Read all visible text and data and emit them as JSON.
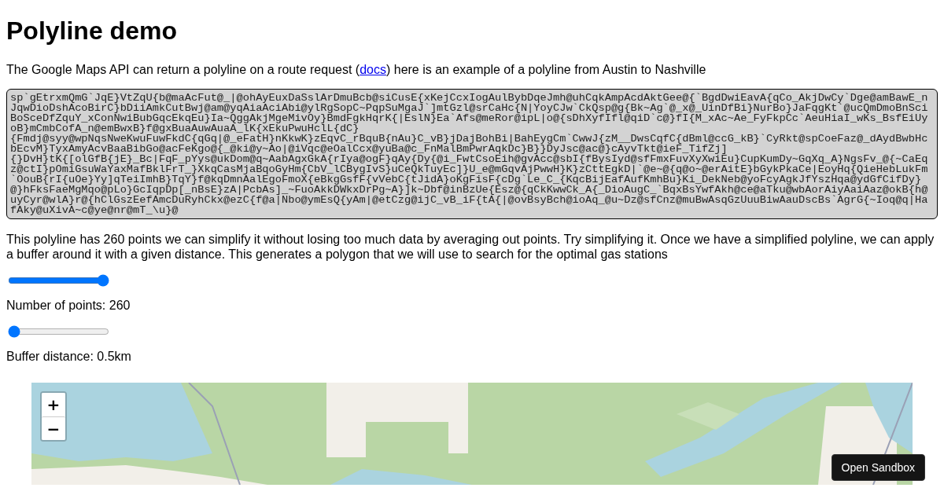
{
  "heading": "Polyline demo",
  "intro": {
    "before": "The Google Maps API can return a polyline on a route request (",
    "link": "docs",
    "after": ") here is an example of a polyline from Austin to Nashville"
  },
  "polyline": [
    "sp`gEtrxmQmG`JqE}VtZqU{b@maAcFut@_|@ohAyEuxDaSslArDmuBcb@siCusE{xKejCcxIogAulBybDqeJmh@uhCqkAmpAcdAktGee@{`BgdDwiEavA{qCo_AkjDwCy`Dge@amBawE_nJqwDioDshAcoBirC}bDiiAmkCutBwj@am@yqAiaAciAbi@ylRgSopC~PqpSuMgaJ`]mtGzl@srCaHc{N|YoyCJw`CkQsp@g{Bk~Ag`@_x@_UinDfBi}NurBo}JaFqgKt`@ucQmDmoBnSciBoSceDfZquY_xConNwiBubGqcEkqEu}Ia~QggAkjMgeMivOy}BmdFgkHqrK{|EslN}Ea`Afs@meRor@ipL|o@{sDhXyfIfl@qiD`c@}fI{M_xAc~Ae_FyFkpCc`AeuHiaI_wKs_BsfEiUyoB}mCmbCofA_n@emBwxB}f@gxBuaAuwAuaA_lK{xEkuPwuHclL{dC}",
    "{Fmdj@syy@wpNqsNweKwuFuwFkdC{qGq|@_eFatH}nKkwK}zEqvC_rBquB{nAu}C_vB}jDajBohBi|BahEygCm`CwwJ{zM__DwsCqfC{dBml@ccG_kB}`CyRkt@spCoeFaz@_dAydBwbHcbEcvM}TyxAmyAcvBaaBibGo@acFeKgo@{_@ki@y~Ao|@iVqc@eOalCcx@yuBa@c_FnMalBmPwrAqkDc}B}}DyJsc@ac@}cAyvTkt@ieF_TifZj]",
    "{}DvH}tK{[olGfB{jE}_Bc|FqF_pYys@ukDom@q~AabAgxGkA{rIya@ogF}qAy{Dy{@i_FwtCsoEih@gvAcc@sbI{fBysIyd@sfFmxFuvXyXwiEu}CupKumDy~GqXq_A}NgsFv_@{~CaEqz@ctI}pOmiGsuWaYaxMafBklFrT_}XkqCasMjaBqoGyHm{CbV_lCBygIvS}uCeQkTuyEc]}U_e@mGqvAjPwwH}K}zCttEgkD|`@e~@{q@o~@erAitE}bGykPkaCe|EoyHq{QieHebLukFm`OouB{rI{uOe}Yy]qTeiImhB}TqY}f@kqDmnAalEgoFmoX{eBkgGsfF{vVebC{tJidA}oKgFisF{cDg`Le_C_{KqcBijEafAufKmhBu}Ki_DekNeb@yoFcyAgkJfYszHqa@ydGfCifDy}@}hFksFaeMgMqo@pLo}GcIqpDp[_nBsE}zA|PcbAs]_~FuoAkkDWkxDrPg~A}]k~Dbf@inBzUe{Esz@{qCkKwwCk_A{_DioAugC_`BqxBsYwfAkh@ce@aTku@wbAorAiyAaiAaz@okB{h@uyCyr@wlA}r@{hClGszEefAmcDuRyhCkx@ezC{f@a|Nbo@ymEsQ{yAm|@etCzg@ijC_vB_iF{tA{|@ovBsyBch@ioAq_@u~Dz@sfCnz@muBwAsqGzUuuBiwAauDscBs`AgrG{~Ioq@q|HafAky@uXivA~c@ye@nr@mT_\\u}@"
  ],
  "explanation": "This polyline has 260 points we can simplify it without losing too much data by averaging out points. Try simplifying it. Once we have a simplified polyline, we can apply a buffer around it with a given distance. This generates a polygon that we will use to search for the optimal gas stations",
  "controls": [
    {
      "level": 1,
      "label": "Number of points: 260"
    },
    {
      "level": 0,
      "label": "Buffer distance: 0.5km"
    }
  ],
  "map": {
    "kind": "picture",
    "zoom_buttons": [
      "+",
      "−"
    ]
  },
  "sandbox_button": "Open Sandbox"
}
